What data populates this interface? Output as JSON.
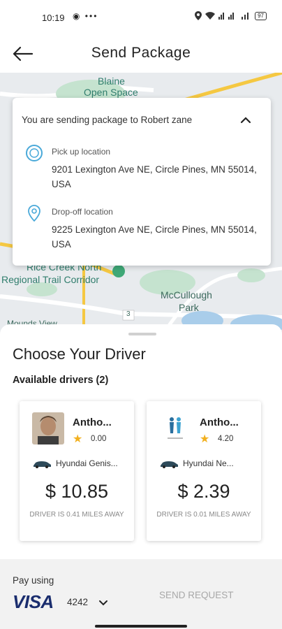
{
  "status_bar": {
    "time": "10:19",
    "left_icons": "◉ •••",
    "battery": "97"
  },
  "header": {
    "title": "Send Package"
  },
  "map": {
    "labels": [
      "Blaine",
      "Open Space",
      "Rice Creek North",
      "Regional Trail Corridor",
      "McCullough",
      "Park",
      "Mounds View",
      "3"
    ]
  },
  "trip": {
    "summary": "You are sending package to Robert zane",
    "pickup": {
      "label": "Pick up location",
      "address": "9201 Lexington Ave NE, Circle Pines, MN 55014, USA"
    },
    "dropoff": {
      "label": "Drop-off location",
      "address": "9225 Lexington Ave NE, Circle Pines, MN 55014, USA"
    },
    "accent_color": "#4aa9d9"
  },
  "drivers_section": {
    "title": "Choose Your Driver",
    "subtitle": "Available drivers (2)"
  },
  "drivers": [
    {
      "name": "Antho...",
      "rating": "0.00",
      "car": "Hyundai Genis...",
      "price": "$ 10.85",
      "distance": "DRIVER IS 0.41 MILES AWAY"
    },
    {
      "name": "Antho...",
      "rating": "4.20",
      "car": "Hyundai Ne...",
      "price": "$ 2.39",
      "distance": "DRIVER IS 0.01 MILES AWAY"
    }
  ],
  "payment": {
    "label": "Pay using",
    "brand": "VISA",
    "last4": "4242",
    "send_label": "SEND REQUEST"
  },
  "colors": {
    "visa_blue": "#1a2d6e",
    "star": "#f2b01e",
    "map_road": "#f5c842"
  }
}
